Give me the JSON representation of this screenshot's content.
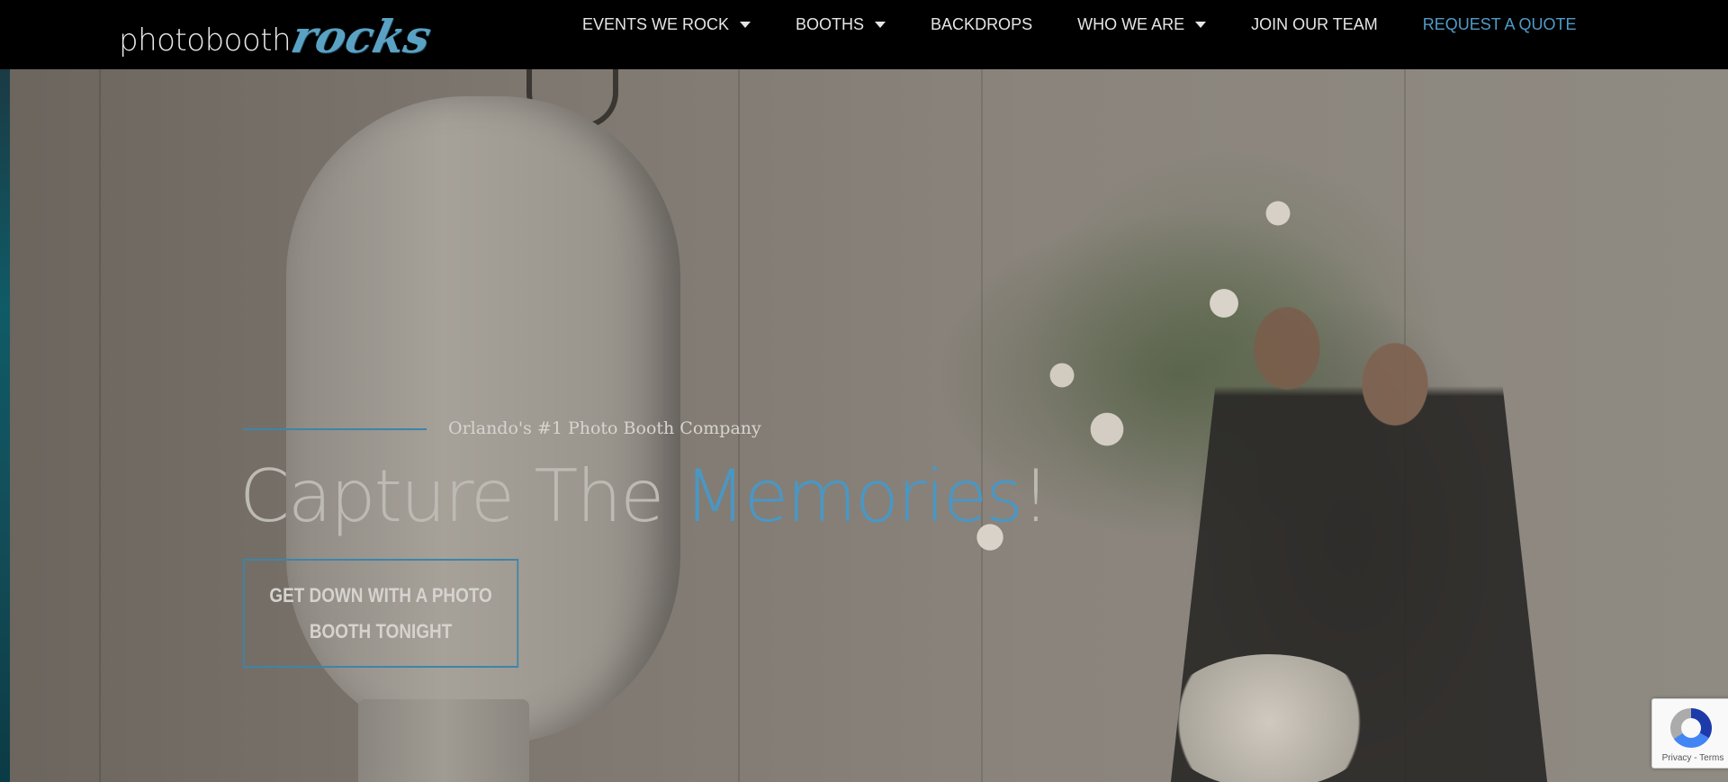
{
  "header": {
    "logo_main": "photobooth",
    "logo_script": "rocks",
    "nav": [
      {
        "label": "EVENTS WE ROCK",
        "has_dropdown": true
      },
      {
        "label": "BOOTHS",
        "has_dropdown": true
      },
      {
        "label": "BACKDROPS",
        "has_dropdown": false
      },
      {
        "label": "WHO WE ARE",
        "has_dropdown": true
      },
      {
        "label": "JOIN OUR TEAM",
        "has_dropdown": false
      },
      {
        "label": "REQUEST A QUOTE",
        "has_dropdown": false
      }
    ]
  },
  "hero": {
    "tagline": "Orlando's #1 Photo Booth Company",
    "headline_part1": "Capture The ",
    "headline_accent": "Memories",
    "headline_end": "!",
    "cta_label": "GET DOWN WITH A PHOTO BOOTH TONIGHT"
  },
  "recaptcha": {
    "text": "Privacy - Terms"
  },
  "colors": {
    "accent": "#4a97c4",
    "nav_text": "#e6e6e6",
    "topbar_bg": "#000000"
  },
  "icons": {
    "dropdown": "caret-down-icon",
    "recaptcha": "recaptcha-icon"
  }
}
